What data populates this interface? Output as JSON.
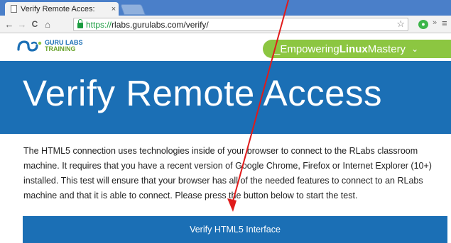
{
  "browser": {
    "tab_title": "Verify Remote Acces:",
    "tab_close": "×",
    "url_scheme": "https://",
    "url_rest": "rlabs.gurulabs.com/verify/",
    "back_icon": "←",
    "forward_icon": "→",
    "reload_icon": "C",
    "home_icon": "⌂",
    "star_icon": "☆",
    "more_icon": "»",
    "menu_icon": "≡"
  },
  "site": {
    "logo_line1": "GURU LABS",
    "logo_line2": "TRAINING",
    "tagline_prefix": "_Empowering",
    "tagline_bold": "Linux",
    "tagline_suffix": "Mastery",
    "tagline_chevron": "⌄"
  },
  "page": {
    "heading": "Verify Remote Access",
    "intro": "The HTML5 connection uses technologies inside of your browser to connect to the RLabs classroom machine. It requires that you have a recent version of Google Chrome, Firefox or Internet Explorer (10+) installed. This test will ensure that your browser has all of the needed features to connect to an RLabs machine and that it is able to connect. Please press the button below to start the test.",
    "verify_button": "Verify HTML5 Interface"
  },
  "colors": {
    "brand_blue": "#1b6fb5",
    "brand_green": "#8cc641",
    "annotation_red": "#e01b1b"
  }
}
